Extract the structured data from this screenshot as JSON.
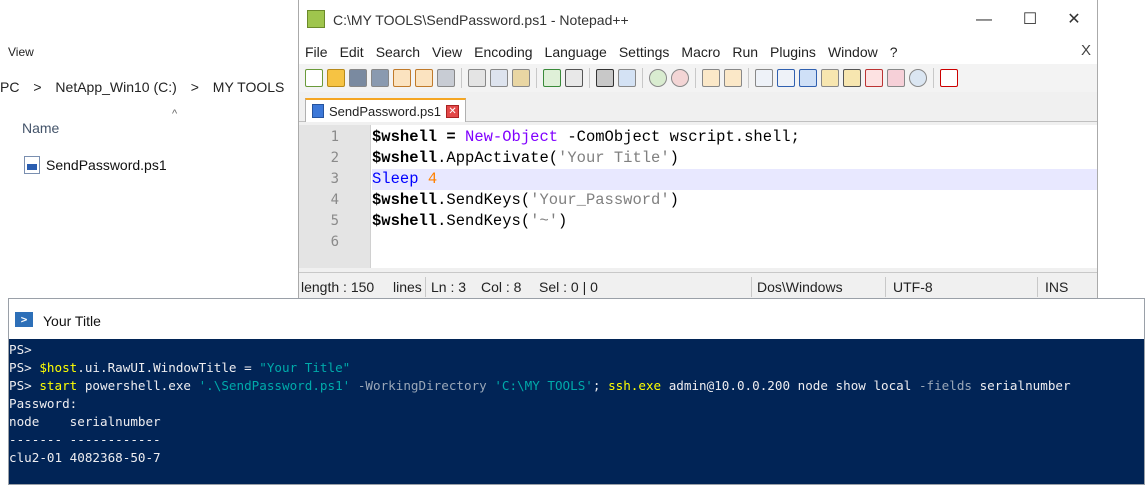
{
  "explorer": {
    "view_label": "View",
    "path": [
      "PC",
      ">",
      "NetApp_Win10 (C:)",
      ">",
      "MY TOOLS"
    ],
    "column_name": "Name",
    "file_name": "SendPassword.ps1"
  },
  "notepad": {
    "title": "C:\\MY TOOLS\\SendPassword.ps1 - Notepad++",
    "controls": {
      "minimize": "—",
      "maximize": "☐",
      "close": "✕"
    },
    "menu": [
      "File",
      "Edit",
      "Search",
      "View",
      "Encoding",
      "Language",
      "Settings",
      "Macro",
      "Run",
      "Plugins",
      "Window",
      "?"
    ],
    "menu_close": "X",
    "tab_label": "SendPassword.ps1",
    "tab_close": "✕",
    "line_numbers": [
      "1",
      "2",
      "3",
      "4",
      "5",
      "6"
    ],
    "code": {
      "l1": [
        "$wshell",
        " = ",
        "New-Object",
        " -ComObject",
        " wscript.shell;"
      ],
      "l2": [
        "$wshell",
        ".AppActivate(",
        "'Your Title'",
        ")"
      ],
      "l3": [
        "Sleep",
        " ",
        "4"
      ],
      "l4": [
        "$wshell",
        ".SendKeys(",
        "'Your_Password'",
        ")"
      ],
      "l5": [
        "$wshell",
        ".SendKeys(",
        "'~'",
        ")"
      ]
    },
    "status": {
      "length": "length : 150",
      "lines": "lines",
      "ln": "Ln : 3",
      "col": "Col : 8",
      "sel": "Sel : 0 | 0",
      "eol": "Dos\\Windows",
      "encoding": "UTF-8",
      "mode": "INS"
    },
    "current_line": 3
  },
  "powershell": {
    "title": "Your Title",
    "lines": {
      "p1": "PS>",
      "p2_prompt": "PS> ",
      "p2_var": "$host",
      "p2_rest": ".ui.RawUI.WindowTitle = ",
      "p2_str": "\"Your Title\"",
      "p3_prompt": "PS> ",
      "p3_cmd": "start",
      "p3_a": " powershell.exe ",
      "p3_s1": "'.\\SendPassword.ps1'",
      "p3_param": " -WorkingDirectory ",
      "p3_s2": "'C:\\MY TOOLS'",
      "p3_semi": "; ",
      "p3_ssh": "ssh.exe",
      "p3_b": " admin@10.0.0.200 node show local ",
      "p3_fields": "-fields",
      "p3_c": " serialnumber",
      "p4": "Password:",
      "p5": "node    serialnumber",
      "p6": "------- ------------",
      "p7": "clu2-01 4082368-50-7"
    }
  }
}
